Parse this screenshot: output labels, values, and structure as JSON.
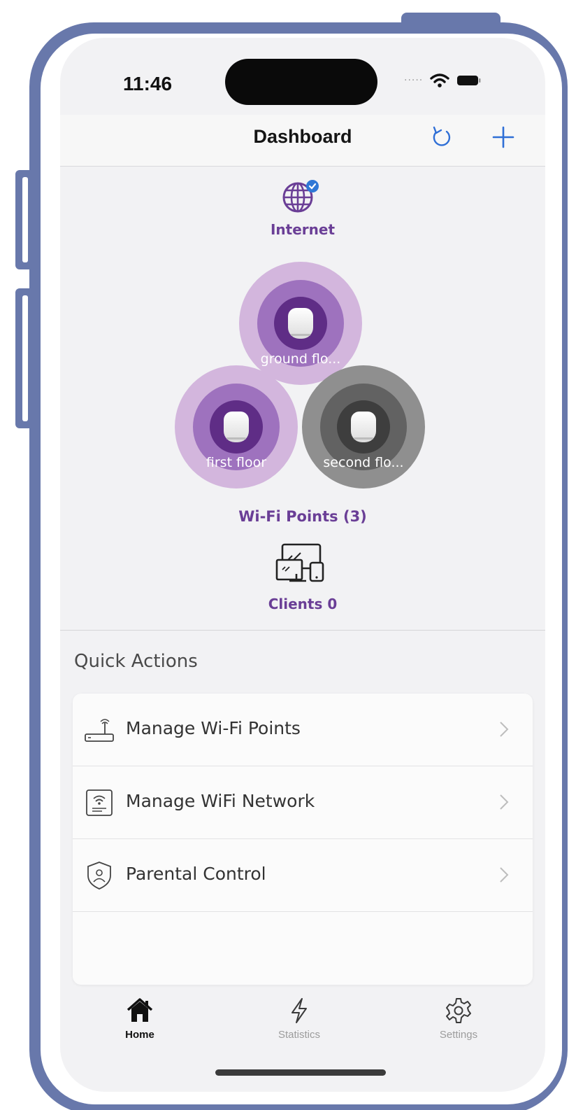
{
  "status_bar": {
    "time": "11:46"
  },
  "header": {
    "title": "Dashboard"
  },
  "topology": {
    "internet_label": "Internet",
    "wifi_points": [
      {
        "label": "ground flo...",
        "status": "online"
      },
      {
        "label": "first floor",
        "status": "online"
      },
      {
        "label": "second flo...",
        "status": "offline"
      }
    ],
    "wifi_points_summary": "Wi-Fi Points (3)",
    "clients_label": "Clients 0"
  },
  "quick_actions": {
    "title": "Quick Actions",
    "items": [
      {
        "label": "Manage Wi-Fi Points",
        "icon": "router-icon"
      },
      {
        "label": "Manage WiFi Network",
        "icon": "wifi-network-icon"
      },
      {
        "label": "Parental Control",
        "icon": "shield-user-icon"
      }
    ]
  },
  "tab_bar": {
    "tabs": [
      {
        "label": "Home",
        "icon": "home-icon",
        "active": true
      },
      {
        "label": "Statistics",
        "icon": "lightning-icon",
        "active": false
      },
      {
        "label": "Settings",
        "icon": "gear-icon",
        "active": false
      }
    ]
  },
  "colors": {
    "accent_purple": "#6a3e96",
    "ios_blue": "#2f6fd6",
    "frame": "#6878ab",
    "offline_gray": "#8f8f8f"
  }
}
